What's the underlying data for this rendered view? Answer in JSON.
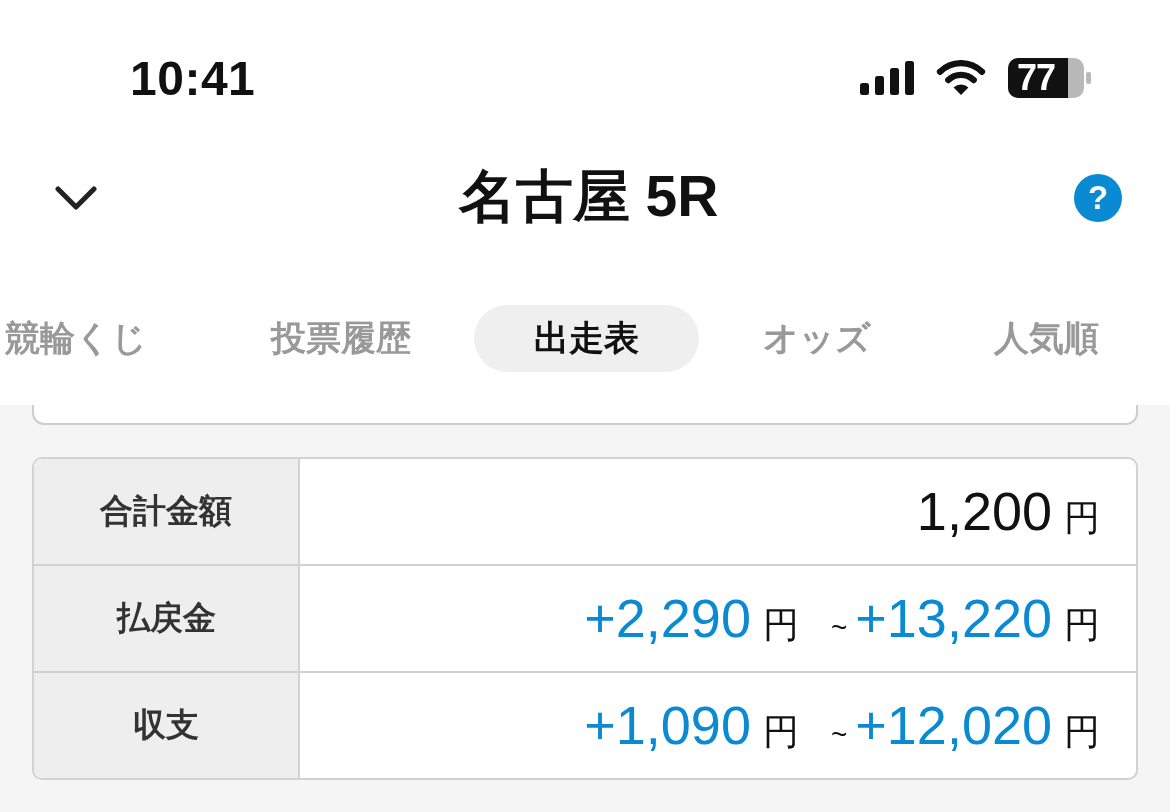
{
  "status_bar": {
    "time": "10:41",
    "battery": "77"
  },
  "header": {
    "title": "名古屋 5R",
    "help": "?"
  },
  "tabs": [
    {
      "label": "競輪くじ",
      "selected": false
    },
    {
      "label": "投票履歴",
      "selected": false
    },
    {
      "label": "出走表",
      "selected": true
    },
    {
      "label": "オッズ",
      "selected": false
    },
    {
      "label": "人気順",
      "selected": false
    }
  ],
  "summary": {
    "rows": [
      {
        "label": "合計金額",
        "amounts": [
          {
            "value": "1,200",
            "unit": "円",
            "positive": false
          }
        ]
      },
      {
        "label": "払戻金",
        "range_separator": "~",
        "amounts": [
          {
            "value": "+2,290",
            "unit": "円",
            "positive": true
          },
          {
            "value": "+13,220",
            "unit": "円",
            "positive": true
          }
        ]
      },
      {
        "label": "収支",
        "range_separator": "~",
        "amounts": [
          {
            "value": "+1,090",
            "unit": "円",
            "positive": true
          },
          {
            "value": "+12,020",
            "unit": "円",
            "positive": true
          }
        ]
      }
    ]
  }
}
